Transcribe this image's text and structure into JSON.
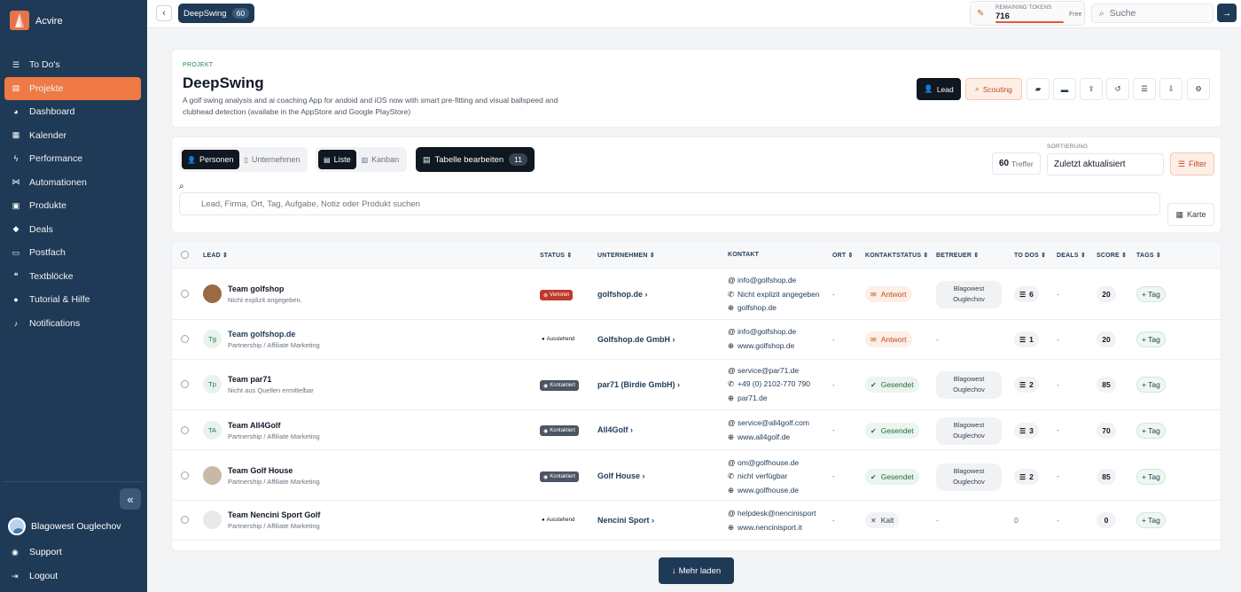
{
  "app": {
    "name": "Acvire"
  },
  "sidebar": {
    "items": [
      {
        "label": "To Do's",
        "icon": "list-icon"
      },
      {
        "label": "Projekte",
        "icon": "folder-icon",
        "active": true
      },
      {
        "label": "Dashboard",
        "icon": "pie-chart-icon"
      },
      {
        "label": "Kalender",
        "icon": "calendar-icon"
      },
      {
        "label": "Performance",
        "icon": "bolt-icon"
      },
      {
        "label": "Automationen",
        "icon": "flow-icon"
      },
      {
        "label": "Produkte",
        "icon": "box-icon"
      },
      {
        "label": "Deals",
        "icon": "tag-icon"
      },
      {
        "label": "Postfach",
        "icon": "inbox-icon"
      },
      {
        "label": "Textblöcke",
        "icon": "quote-icon"
      },
      {
        "label": "Tutorial & Hilfe",
        "icon": "help-icon"
      },
      {
        "label": "Notifications",
        "icon": "bell-icon"
      }
    ],
    "user": "Blagowest Ouglechov",
    "support": "Support",
    "logout": "Logout"
  },
  "topbar": {
    "breadcrumb": "DeepSwing",
    "breadcrumb_count": "60",
    "tokens_label": "REMAINING TOKENS",
    "tokens_value": "716",
    "tokens_plan": "Free",
    "tokens_fraction": 0.99,
    "search_placeholder": "Suche"
  },
  "project": {
    "kicker": "PROJEKT",
    "title": "DeepSwing",
    "description": "A golf swing analysis and ai coaching App for andoid and iOS now with smart pre-fitting and visual ballspeed and clubhead detection (availabe in the AppStore and Google PlayStore)",
    "lead_button": "Lead",
    "scouting_button": "Scouting"
  },
  "listbar": {
    "view_persons": "Personen",
    "view_companies": "Unternehmen",
    "mode_list": "Liste",
    "mode_kanban": "Kanban",
    "edit_table": "Tabelle bearbeiten",
    "edit_count": "11",
    "hits": "60",
    "hits_label": "Treffer",
    "sort_label": "SORTIERUNG",
    "sort_value": "Zuletzt aktualisiert",
    "filter": "Filter",
    "search_placeholder": "Lead, Firma, Ort, Tag, Aufgabe, Notiz oder Produkt suchen",
    "map": "Karte"
  },
  "table": {
    "headers": {
      "lead": "LEAD",
      "status": "STATUS",
      "company": "UNTERNEHMEN",
      "contact": "KONTAKT",
      "ort": "ORT",
      "kstatus": "KONTAKTSTATUS",
      "betreuer": "BETREUER",
      "todos": "TO DOS",
      "deals": "DEALS",
      "score": "SCORE",
      "tags": "TAGS"
    },
    "rows": [
      {
        "name": "Team golfshop",
        "sub": "Nicht explizit angegeben.",
        "initials": "",
        "status": "Verloren",
        "company": "golfshop.de",
        "contact": [
          "info@golfshop.de",
          "Nicht explizit angegeben",
          "golfshop.de"
        ],
        "ort": "-",
        "kstatus": "Antwort",
        "betreuer": [
          "Blagowest",
          "Ouglechov"
        ],
        "todos": "6",
        "deals": "-",
        "score": "20",
        "tag": "+ Tag"
      },
      {
        "name": "Team golfshop.de",
        "sub": "Partnership / Affiliate Marketing",
        "initials": "Tg",
        "status": "Ausstehend",
        "company": "Golfshop.de GmbH",
        "contact": [
          "info@golfshop.de",
          "www.golfshop.de"
        ],
        "ort": "-",
        "kstatus": "Antwort",
        "betreuer_text": "-",
        "todos": "1",
        "deals": "-",
        "score": "20",
        "tag": "+ Tag"
      },
      {
        "name": "Team par71",
        "sub": "Nicht aus Quellen ermittelbar",
        "initials": "Tp",
        "status": "Kontaktiert",
        "company": "par71 (Birdie GmbH)",
        "contact": [
          "service@par71.de",
          "+49 (0) 2102-770 790",
          "par71.de"
        ],
        "ort": "-",
        "kstatus": "Gesendet",
        "betreuer": [
          "Blagowest",
          "Ouglechov"
        ],
        "todos": "2",
        "deals": "-",
        "score": "85",
        "tag": "+ Tag"
      },
      {
        "name": "Team All4Golf",
        "sub": "Partnership / Affiliate Marketing",
        "initials": "TA",
        "status": "Kontaktiert",
        "company": "All4Golf",
        "contact": [
          "service@all4golf.com",
          "www.all4golf.de"
        ],
        "ort": "-",
        "kstatus": "Gesendet",
        "betreuer": [
          "Blagowest",
          "Ouglechov"
        ],
        "todos": "3",
        "deals": "-",
        "score": "70",
        "tag": "+ Tag"
      },
      {
        "name": "Team Golf House",
        "sub": "Partnership / Affiliate Marketing",
        "initials": "",
        "status": "Kontaktiert",
        "company": "Golf House",
        "contact": [
          "om@golfhouse.de",
          "nicht verfügbar",
          "www.golfhouse.de"
        ],
        "ort": "-",
        "kstatus": "Gesendet",
        "betreuer": [
          "Blagowest",
          "Ouglechov"
        ],
        "todos": "2",
        "deals": "-",
        "score": "85",
        "tag": "+ Tag"
      },
      {
        "name": "Team Nencini Sport Golf",
        "sub": "Partnership / Affiliate Marketing",
        "initials": "",
        "status": "Ausstehend",
        "company": "Nencini Sport",
        "contact": [
          "helpdesk@nencinisport",
          "www.nencinisport.it"
        ],
        "ort": "-",
        "kstatus": "Kalt",
        "betreuer_text": "-",
        "todos_text": "0",
        "deals": "-",
        "score": "0",
        "tag": "+ Tag"
      }
    ]
  },
  "load_more": "Mehr laden"
}
